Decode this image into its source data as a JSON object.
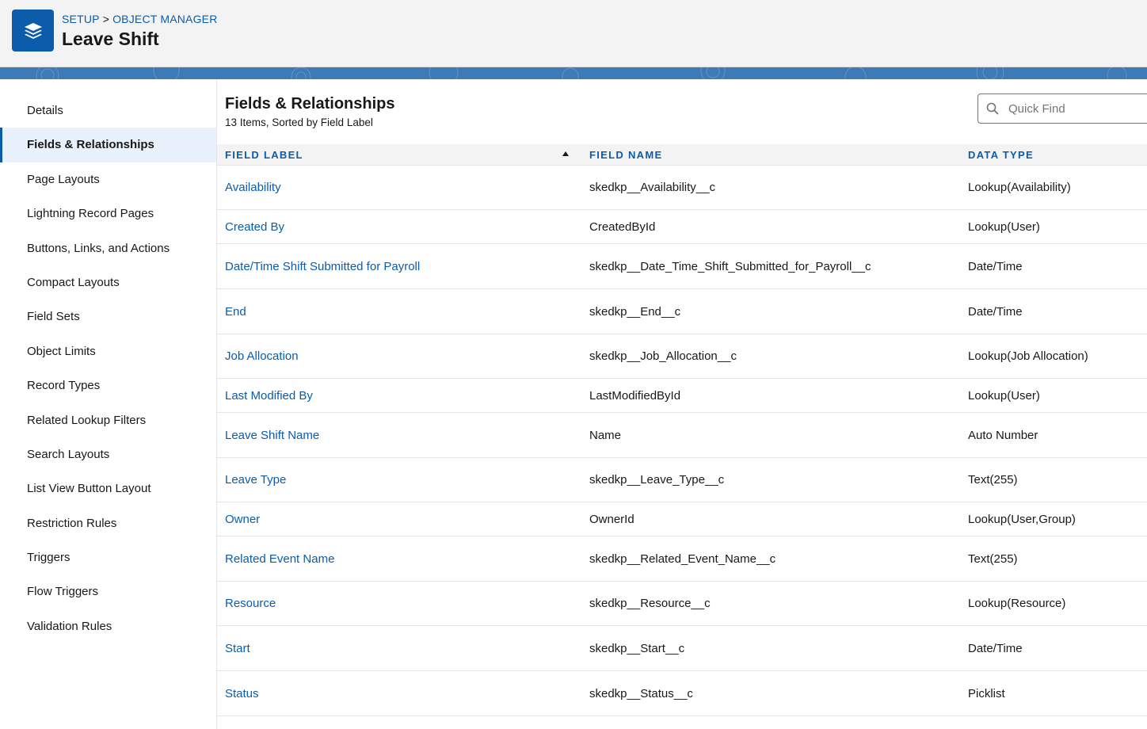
{
  "header": {
    "breadcrumb": {
      "setup": "SETUP",
      "separator": ">",
      "object_manager": "OBJECT MANAGER"
    },
    "title": "Leave Shift",
    "icon": "stack-layers-icon",
    "icon_bg": "#0b5cab"
  },
  "sidebar": {
    "items": [
      {
        "label": "Details"
      },
      {
        "label": "Fields & Relationships",
        "active": true
      },
      {
        "label": "Page Layouts"
      },
      {
        "label": "Lightning Record Pages"
      },
      {
        "label": "Buttons, Links, and Actions"
      },
      {
        "label": "Compact Layouts"
      },
      {
        "label": "Field Sets"
      },
      {
        "label": "Object Limits"
      },
      {
        "label": "Record Types"
      },
      {
        "label": "Related Lookup Filters"
      },
      {
        "label": "Search Layouts"
      },
      {
        "label": "List View Button Layout"
      },
      {
        "label": "Restriction Rules"
      },
      {
        "label": "Triggers"
      },
      {
        "label": "Flow Triggers"
      },
      {
        "label": "Validation Rules"
      }
    ]
  },
  "main": {
    "title": "Fields & Relationships",
    "subtitle": "13 Items, Sorted by Field Label",
    "quick_find": {
      "placeholder": "Quick Find",
      "value": ""
    },
    "table": {
      "headers": {
        "field_label": "FIELD LABEL",
        "field_name": "FIELD NAME",
        "data_type": "DATA TYPE"
      },
      "sort": "ascending",
      "rows": [
        {
          "label": "Availability",
          "name": "skedkp__Availability__c",
          "type": "Lookup(Availability)"
        },
        {
          "label": "Created By",
          "name": "CreatedById",
          "type": "Lookup(User)"
        },
        {
          "label": "Date/Time Shift Submitted for Payroll",
          "name": "skedkp__Date_Time_Shift_Submitted_for_Payroll__c",
          "type": "Date/Time"
        },
        {
          "label": "End",
          "name": "skedkp__End__c",
          "type": "Date/Time"
        },
        {
          "label": "Job Allocation",
          "name": "skedkp__Job_Allocation__c",
          "type": "Lookup(Job Allocation)"
        },
        {
          "label": "Last Modified By",
          "name": "LastModifiedById",
          "type": "Lookup(User)"
        },
        {
          "label": "Leave Shift Name",
          "name": "Name",
          "type": "Auto Number"
        },
        {
          "label": "Leave Type",
          "name": "skedkp__Leave_Type__c",
          "type": "Text(255)"
        },
        {
          "label": "Owner",
          "name": "OwnerId",
          "type": "Lookup(User,Group)"
        },
        {
          "label": "Related Event Name",
          "name": "skedkp__Related_Event_Name__c",
          "type": "Text(255)"
        },
        {
          "label": "Resource",
          "name": "skedkp__Resource__c",
          "type": "Lookup(Resource)"
        },
        {
          "label": "Start",
          "name": "skedkp__Start__c",
          "type": "Date/Time"
        },
        {
          "label": "Status",
          "name": "skedkp__Status__c",
          "type": "Picklist"
        }
      ]
    }
  },
  "colors": {
    "link": "#0b5cab",
    "band": "#3e7ab7",
    "active_bg": "#e8f1fc"
  }
}
